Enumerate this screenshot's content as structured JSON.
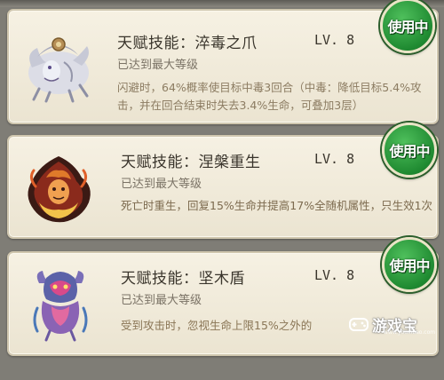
{
  "skills": [
    {
      "name": "天赋技能：淬毒之爪",
      "level": "LV. 8",
      "status": "已达到最大等级",
      "description": "闪避时，64%概率使目标中毒3回合（中毒：降低目标5.4%攻击，并在回合结束时失去3.4%生命，可叠加3层）",
      "badge": "使用中",
      "icon": "white-tiger-beast-icon"
    },
    {
      "name": "天赋技能：涅槃重生",
      "level": "LV. 8",
      "status": "已达到最大等级",
      "description": "死亡时重生，回复15%生命并提高17%全随机属性，只生效1次",
      "badge": "使用中",
      "icon": "flame-phoenix-icon"
    },
    {
      "name": "天赋技能：坚木盾",
      "level": "LV. 8",
      "status": "已达到最大等级",
      "description": "受到攻击时，忽视生命上限15%之外的",
      "badge": "使用中",
      "icon": "wood-spirit-icon"
    }
  ],
  "watermark": {
    "text": "游戏宝",
    "url": "www.youxibao.com"
  },
  "colors": {
    "badge_green": "#1f8a31",
    "card_bg": "#f3eddd",
    "desc_text": "#8c7c62"
  }
}
